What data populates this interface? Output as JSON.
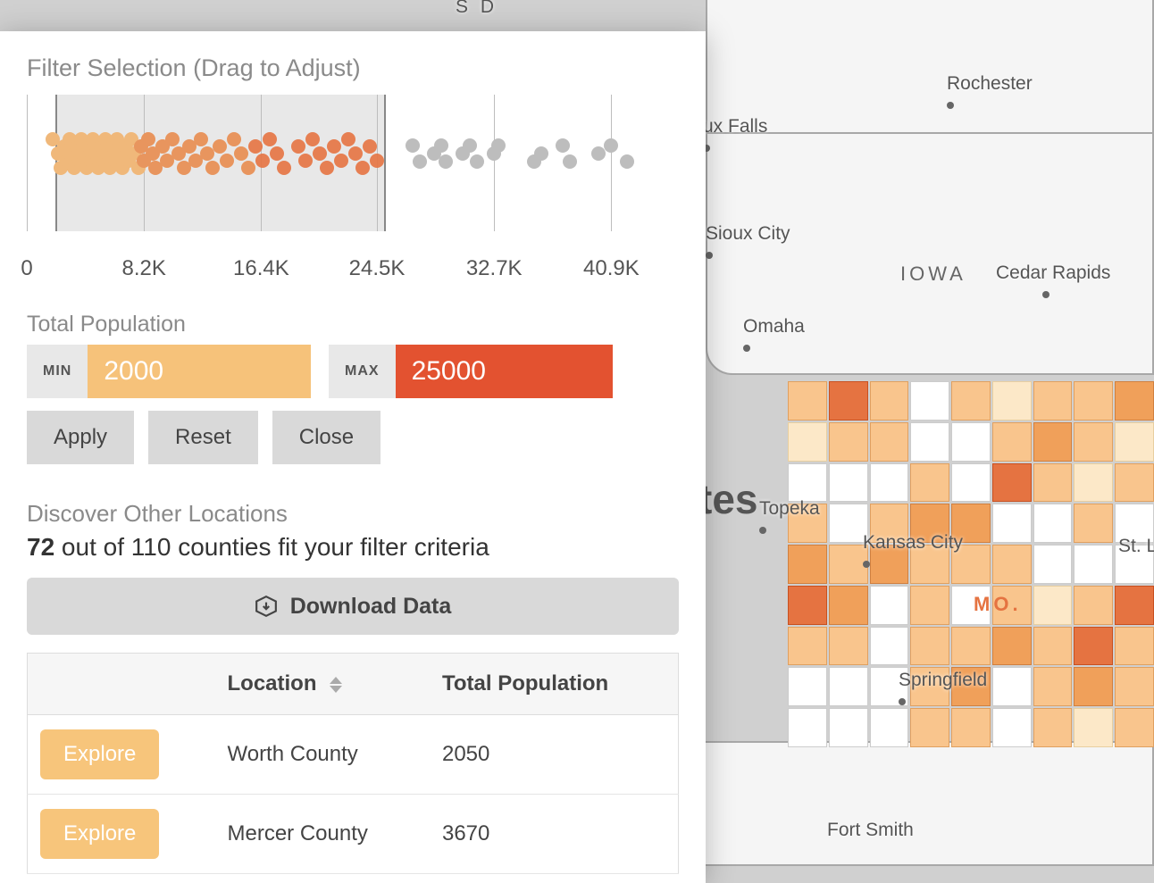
{
  "filter": {
    "title": "Filter Selection (Drag to Adjust)",
    "population_label": "Total Population",
    "min_label": "MIN",
    "max_label": "MAX",
    "min_value": "2000",
    "max_value": "25000",
    "apply": "Apply",
    "reset": "Reset",
    "close": "Close"
  },
  "chart_data": {
    "type": "scatter",
    "xlabel": "Total Population",
    "ylabel": "",
    "xlim": [
      0,
      45000
    ],
    "ticks": [
      "0",
      "8.2K",
      "16.4K",
      "24.5K",
      "32.7K",
      "40.9K"
    ],
    "selection": {
      "min": 2000,
      "max": 25000
    },
    "series": [
      {
        "name": "in-range",
        "values": [
          1800,
          2200,
          2400,
          2600,
          2800,
          3000,
          3000,
          3300,
          3500,
          3700,
          3800,
          3900,
          4200,
          4300,
          4500,
          4600,
          4800,
          5000,
          5200,
          5400,
          5500,
          5600,
          5800,
          6000,
          6200,
          6300,
          6500,
          6700,
          6900,
          7100,
          7300,
          7500,
          7800,
          8000,
          8200,
          8500,
          8800,
          9000,
          9500,
          9800,
          10200,
          10600,
          11000,
          11400,
          11800,
          12200,
          12600,
          13000,
          13500,
          14000,
          14500,
          15000,
          15500,
          16000,
          16500,
          17000,
          17500,
          18000,
          19000,
          19500,
          20000,
          20500,
          21000,
          21500,
          22000,
          22500,
          23000,
          23500,
          24000,
          24500
        ]
      },
      {
        "name": "out-range",
        "values": [
          27000,
          27500,
          28500,
          29000,
          29300,
          30500,
          31000,
          31500,
          32700,
          33000,
          35500,
          36000,
          37500,
          38000,
          40000,
          40900,
          42000
        ]
      }
    ]
  },
  "discover": {
    "title": "Discover Other Locations",
    "count": "72",
    "total": "110",
    "sub_prefix": " out of ",
    "sub_suffix": " counties fit your filter criteria",
    "download": "Download Data"
  },
  "table": {
    "col_location": "Location",
    "col_population": "Total Population",
    "explore": "Explore",
    "rows": [
      {
        "location": "Worth County",
        "pop": "2050"
      },
      {
        "location": "Mercer County",
        "pop": "3670"
      }
    ]
  },
  "map": {
    "iowa": "IOWA",
    "mo": "MO.",
    "tes": "tes",
    "cities": {
      "rochester": "Rochester",
      "sioux_falls": "ux Falls",
      "sioux_city": "Sioux City",
      "cedar_rapids": "Cedar Rapids",
      "omaha": "Omaha",
      "topeka": "Topeka",
      "kc": "Kansas City",
      "stl": "St. L",
      "springfield": "Springfield",
      "fort_smith": "Fort Smith",
      "sd": "S D"
    }
  }
}
